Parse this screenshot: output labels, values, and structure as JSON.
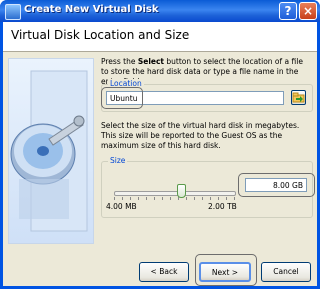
{
  "window": {
    "title": "Create New Virtual Disk"
  },
  "header": {
    "title": "Virtual Disk Location and Size"
  },
  "location": {
    "desc_pre": "Press the ",
    "desc_bold": "Select",
    "desc_post": " button to select the location of a file to store the hard disk data or type a file name in the entry field.",
    "group_label": "Location",
    "value": "Ubuntu"
  },
  "size": {
    "desc": "Select the size of the virtual hard disk in megabytes. This size will be reported to the Guest OS as the maximum size of this hard disk.",
    "group_label": "Size",
    "value": "8.00 GB",
    "min_label": "4.00 MB",
    "max_label": "2.00 TB"
  },
  "buttons": {
    "back": "< Back",
    "next": "Next >",
    "cancel": "Cancel"
  },
  "titlebar": {
    "help": "?",
    "close": "×"
  }
}
